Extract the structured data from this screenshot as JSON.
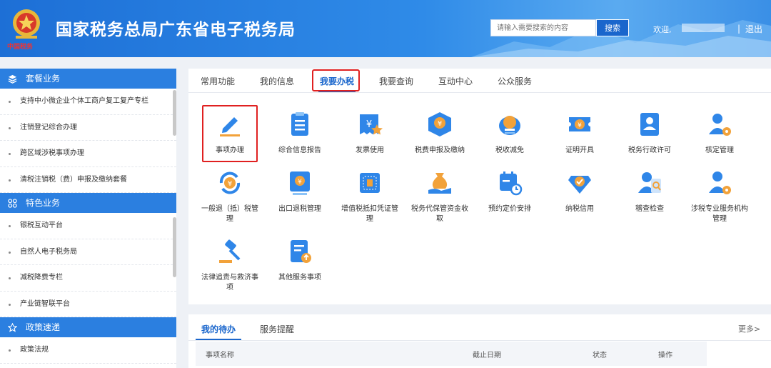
{
  "header": {
    "title": "国家税务总局广东省电子税务局",
    "search_placeholder": "请输入需要搜索的内容",
    "search_button": "搜索",
    "welcome": "欢迎,",
    "separator": "|",
    "logout": "退出",
    "emblem_text": "中国税务"
  },
  "sidebar": {
    "sections": [
      {
        "title": "套餐业务",
        "icon": "layers-icon",
        "items": [
          "支持中小微企业个体工商户复工复产专栏",
          "注销登记综合办理",
          "跨区域涉税事项办理",
          "清税注销税（费）申报及缴纳套餐"
        ]
      },
      {
        "title": "特色业务",
        "icon": "grid-icon",
        "items": [
          "银税互动平台",
          "自然人电子税务局",
          "减税降费专栏",
          "产业链智联平台"
        ]
      },
      {
        "title": "政策速递",
        "icon": "star-icon",
        "items": [
          "政策法规"
        ]
      }
    ]
  },
  "tabs": [
    {
      "label": "常用功能",
      "active": false
    },
    {
      "label": "我的信息",
      "active": false
    },
    {
      "label": "我要办税",
      "active": true
    },
    {
      "label": "我要查询",
      "active": false
    },
    {
      "label": "互动中心",
      "active": false
    },
    {
      "label": "公众服务",
      "active": false
    }
  ],
  "services": [
    {
      "label": "事项办理",
      "icon": "pencil-icon",
      "selected": true
    },
    {
      "label": "综合信息报告",
      "icon": "document-icon"
    },
    {
      "label": "发票使用",
      "icon": "invoice-icon"
    },
    {
      "label": "税费申报及缴纳",
      "icon": "tax-box-icon"
    },
    {
      "label": "税收减免",
      "icon": "coin-stack-icon"
    },
    {
      "label": "证明开具",
      "icon": "ticket-icon"
    },
    {
      "label": "税务行政许可",
      "icon": "id-card-icon"
    },
    {
      "label": "核定管理",
      "icon": "user-gear-icon"
    },
    {
      "label": "一般退（抵）税管理",
      "icon": "refund-icon"
    },
    {
      "label": "出口退税管理",
      "icon": "export-refund-icon"
    },
    {
      "label": "增值税抵扣凭证管理",
      "icon": "vat-voucher-icon"
    },
    {
      "label": "税务代保管资金收取",
      "icon": "money-bag-icon"
    },
    {
      "label": "预约定价安排",
      "icon": "calendar-clock-icon"
    },
    {
      "label": "纳税信用",
      "icon": "heart-check-icon"
    },
    {
      "label": "稽查检查",
      "icon": "inspect-icon"
    },
    {
      "label": "涉税专业服务机构管理",
      "icon": "agency-gear-icon"
    },
    {
      "label": "法律追责与救济事项",
      "icon": "gavel-icon"
    },
    {
      "label": "其他服务事项",
      "icon": "other-service-icon"
    }
  ],
  "todo": {
    "tab_active": "我的待办",
    "tab_other": "服务提醒",
    "more": "更多>",
    "columns": [
      "事项名称",
      "截止日期",
      "状态",
      "操作"
    ]
  }
}
